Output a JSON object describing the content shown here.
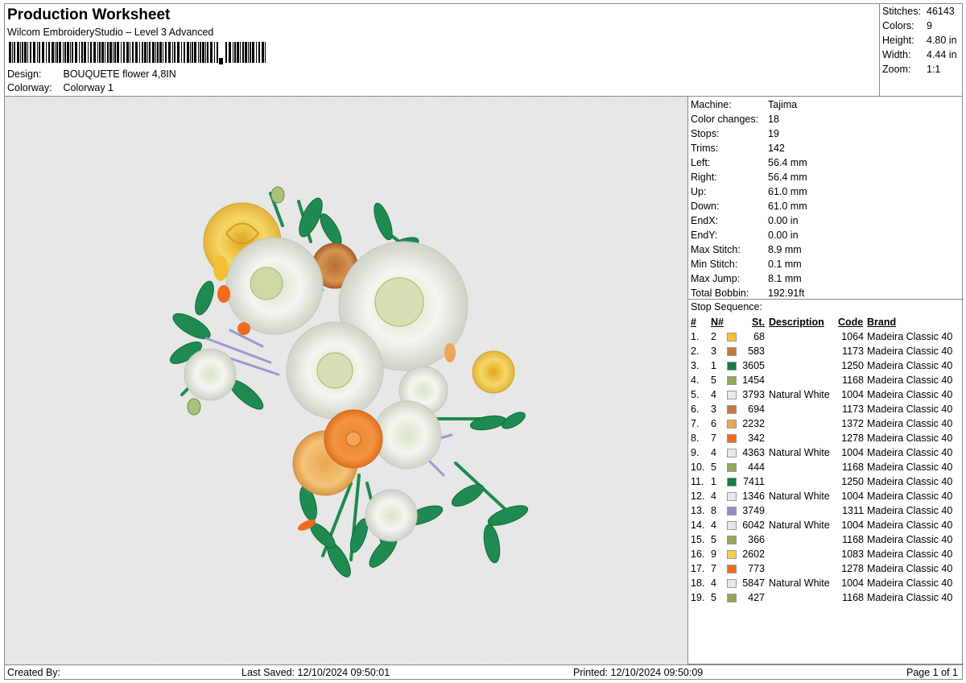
{
  "header": {
    "title": "Production Worksheet",
    "subtitle": "Wilcom EmbroideryStudio – Level 3 Advanced",
    "design_label": "Design:",
    "design_value": "BOUQUETE flower 4,8IN",
    "colorway_label": "Colorway:",
    "colorway_value": "Colorway 1"
  },
  "summary": [
    {
      "label": "Stitches:",
      "value": "46143"
    },
    {
      "label": "Colors:",
      "value": "9"
    },
    {
      "label": "Height:",
      "value": "4.80 in"
    },
    {
      "label": "Width:",
      "value": "4.44 in"
    },
    {
      "label": "Zoom:",
      "value": "1:1"
    }
  ],
  "machine_info": [
    {
      "label": "Machine:",
      "value": "Tajima"
    },
    {
      "label": "Color changes:",
      "value": "18"
    },
    {
      "label": "Stops:",
      "value": "19"
    },
    {
      "label": "Trims:",
      "value": "142"
    },
    {
      "label": "Left:",
      "value": "56.4 mm"
    },
    {
      "label": "Right:",
      "value": "56.4 mm"
    },
    {
      "label": "Up:",
      "value": "61.0 mm"
    },
    {
      "label": "Down:",
      "value": "61.0 mm"
    },
    {
      "label": "EndX:",
      "value": "0.00 in"
    },
    {
      "label": "EndY:",
      "value": "0.00 in"
    },
    {
      "label": "Max Stitch:",
      "value": "8.9 mm"
    },
    {
      "label": "Min Stitch:",
      "value": "0.1 mm"
    },
    {
      "label": "Max Jump:",
      "value": "8.1 mm"
    },
    {
      "label": "Total Bobbin:",
      "value": "192.91ft"
    }
  ],
  "stop_sequence": {
    "title": "Stop Sequence:",
    "headers": {
      "num": "#",
      "n": "N#",
      "st": "St.",
      "desc": "Description",
      "code": "Code",
      "brand": "Brand"
    },
    "rows": [
      {
        "num": "1.",
        "n": "2",
        "color": "#f2c12e",
        "st": "68",
        "desc": "",
        "code": "1064",
        "brand": "Madeira Classic 40"
      },
      {
        "num": "2.",
        "n": "3",
        "color": "#c27a3e",
        "st": "583",
        "desc": "",
        "code": "1173",
        "brand": "Madeira Classic 40"
      },
      {
        "num": "3.",
        "n": "1",
        "color": "#1a7a46",
        "st": "3605",
        "desc": "",
        "code": "1250",
        "brand": "Madeira Classic 40"
      },
      {
        "num": "4.",
        "n": "5",
        "color": "#8fa85a",
        "st": "1454",
        "desc": "",
        "code": "1168",
        "brand": "Madeira Classic 40"
      },
      {
        "num": "5.",
        "n": "4",
        "color": "#e8e8e8",
        "st": "3793",
        "desc": "Natural White",
        "code": "1004",
        "brand": "Madeira Classic 40"
      },
      {
        "num": "6.",
        "n": "3",
        "color": "#c27a3e",
        "st": "694",
        "desc": "",
        "code": "1173",
        "brand": "Madeira Classic 40"
      },
      {
        "num": "7.",
        "n": "6",
        "color": "#eda756",
        "st": "2232",
        "desc": "",
        "code": "1372",
        "brand": "Madeira Classic 40"
      },
      {
        "num": "8.",
        "n": "7",
        "color": "#f06b1e",
        "st": "342",
        "desc": "",
        "code": "1278",
        "brand": "Madeira Classic 40"
      },
      {
        "num": "9.",
        "n": "4",
        "color": "#e8e8e8",
        "st": "4363",
        "desc": "Natural White",
        "code": "1004",
        "brand": "Madeira Classic 40"
      },
      {
        "num": "10.",
        "n": "5",
        "color": "#8fa85a",
        "st": "444",
        "desc": "",
        "code": "1168",
        "brand": "Madeira Classic 40"
      },
      {
        "num": "11.",
        "n": "1",
        "color": "#1a7a46",
        "st": "7411",
        "desc": "",
        "code": "1250",
        "brand": "Madeira Classic 40"
      },
      {
        "num": "12.",
        "n": "4",
        "color": "#e8e8e8",
        "st": "1346",
        "desc": "Natural White",
        "code": "1004",
        "brand": "Madeira Classic 40"
      },
      {
        "num": "13.",
        "n": "8",
        "color": "#8f8fc2",
        "st": "3749",
        "desc": "",
        "code": "1311",
        "brand": "Madeira Classic 40"
      },
      {
        "num": "14.",
        "n": "4",
        "color": "#e8e8e8",
        "st": "6042",
        "desc": "Natural White",
        "code": "1004",
        "brand": "Madeira Classic 40"
      },
      {
        "num": "15.",
        "n": "5",
        "color": "#8fa85a",
        "st": "366",
        "desc": "",
        "code": "1168",
        "brand": "Madeira Classic 40"
      },
      {
        "num": "16.",
        "n": "9",
        "color": "#f7cd55",
        "st": "2602",
        "desc": "",
        "code": "1083",
        "brand": "Madeira Classic 40"
      },
      {
        "num": "17.",
        "n": "7",
        "color": "#f06b1e",
        "st": "773",
        "desc": "",
        "code": "1278",
        "brand": "Madeira Classic 40"
      },
      {
        "num": "18.",
        "n": "4",
        "color": "#e8e8e8",
        "st": "5847",
        "desc": "Natural White",
        "code": "1004",
        "brand": "Madeira Classic 40"
      },
      {
        "num": "19.",
        "n": "5",
        "color": "#8fa85a",
        "st": "427",
        "desc": "",
        "code": "1168",
        "brand": "Madeira Classic 40"
      }
    ]
  },
  "footer": {
    "created_by": "Created By:",
    "last_saved": "Last Saved: 12/10/2024 09:50:01",
    "printed": "Printed: 12/10/2024 09:50:09",
    "page": "Page 1 of 1"
  },
  "preview": {
    "image": "embroidered-flower-bouquet-icon"
  }
}
